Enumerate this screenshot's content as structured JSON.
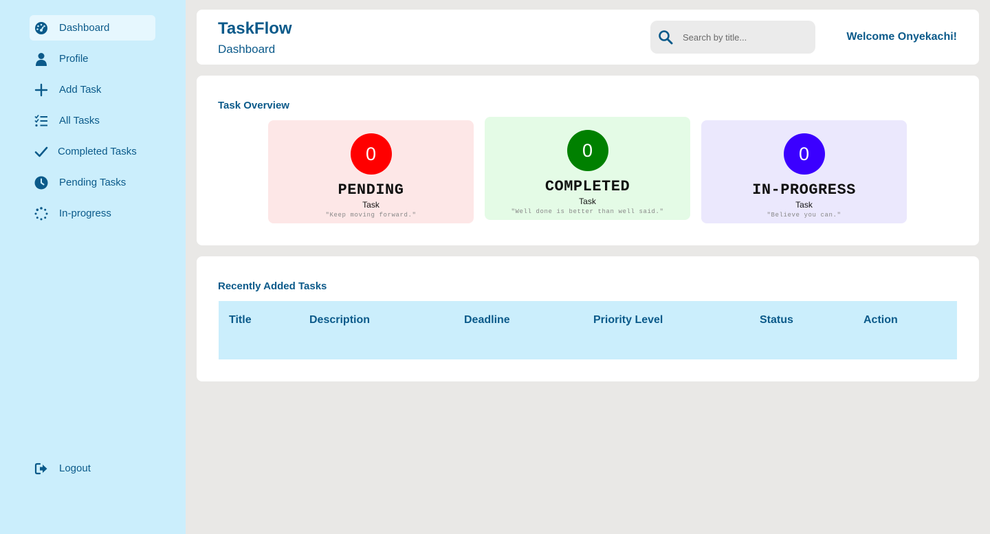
{
  "sidebar": {
    "items": [
      {
        "label": "Dashboard",
        "icon": "gauge-icon"
      },
      {
        "label": "Profile",
        "icon": "user-icon"
      },
      {
        "label": "Add Task",
        "icon": "plus-icon"
      },
      {
        "label": "All Tasks",
        "icon": "list-check-icon"
      },
      {
        "label": "Completed Tasks",
        "icon": "check-icon"
      },
      {
        "label": "Pending Tasks",
        "icon": "clock-icon"
      },
      {
        "label": "In-progress",
        "icon": "spinner-icon"
      }
    ],
    "logout": {
      "label": "Logout",
      "icon": "logout-icon"
    }
  },
  "header": {
    "brand": "TaskFlow",
    "subtitle": "Dashboard",
    "search_placeholder": "Search by title...",
    "welcome": "Welcome Onyekachi!"
  },
  "overview": {
    "title": "Task Overview",
    "cards": [
      {
        "count": "0",
        "title": "PENDING",
        "sub": "Task",
        "quote": "\"Keep moving forward.\"",
        "bg": "#fde7e7",
        "circle": "#ff0000"
      },
      {
        "count": "0",
        "title": "COMPLETED",
        "sub": "Task",
        "quote": "\"Well done is better than well said.\"",
        "bg": "#e4fbe6",
        "circle": "#008000"
      },
      {
        "count": "0",
        "title": "IN-PROGRESS",
        "sub": "Task",
        "quote": "\"Believe you can.\"",
        "bg": "#ebe8fd",
        "circle": "#3b00ff"
      }
    ]
  },
  "recent": {
    "title": "Recently Added Tasks",
    "columns": [
      "Title",
      "Description",
      "Deadline",
      "Priority Level",
      "Status",
      "Action"
    ]
  },
  "colors": {
    "accent": "#0b5a8a",
    "sidebar_bg": "#cbeefc",
    "page_bg": "#e9e8e6"
  }
}
